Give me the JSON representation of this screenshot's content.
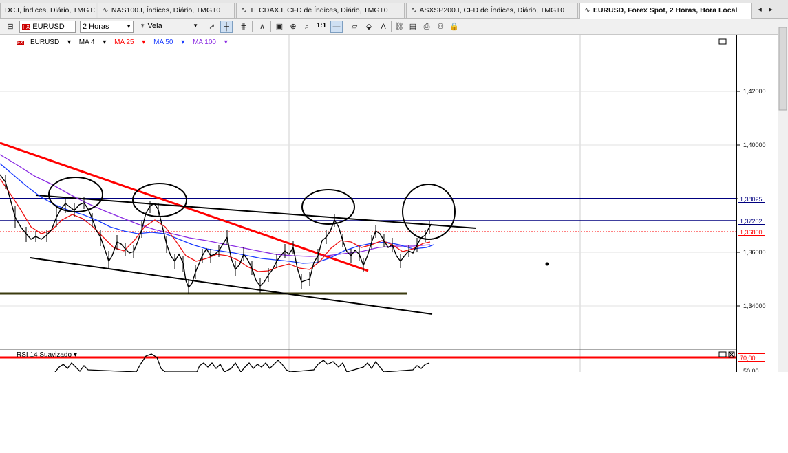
{
  "tabs": [
    {
      "label": "DC.I, Índices, Diário, TMG+0",
      "active": false
    },
    {
      "label": "NAS100.I, Índices, Diário, TMG+0",
      "active": false
    },
    {
      "label": "TECDAX.I, CFD de Índices, Diário, TMG+0",
      "active": false
    },
    {
      "label": "ASXSP200.I, CFD de Índices, Diário, TMG+0",
      "active": false
    },
    {
      "label": "EURUSD, Forex Spot, 2 Horas, Hora Local",
      "active": true
    }
  ],
  "toolbar": {
    "symbol_prefix": "FX",
    "symbol": "EURUSD",
    "timeframe": "2 Horas",
    "chart_style": "Vela",
    "ratio_label": "1:1"
  },
  "legend": {
    "symbol": "EURUSD",
    "ma4": "MA 4",
    "ma25": "MA 25",
    "ma50": "MA 50",
    "ma100": "MA 100"
  },
  "colors": {
    "ma4": "#000000",
    "ma25": "#ff0000",
    "ma50": "#1a3cff",
    "ma100": "#8a2be2",
    "resistance": "#00007f",
    "support": "#3b3b0f",
    "trendline": "#000000",
    "red_trend": "#ff0000"
  },
  "price_axis": {
    "ticks": [
      "1,42000",
      "1,40000",
      "1,38000",
      "1,36000",
      "1,34000"
    ],
    "tags": [
      "1,38025",
      "1,37202",
      "1,36800"
    ]
  },
  "rsi": {
    "label": "RSI 14 Suavizado",
    "level": "70,00",
    "level2": "50,00"
  }
}
